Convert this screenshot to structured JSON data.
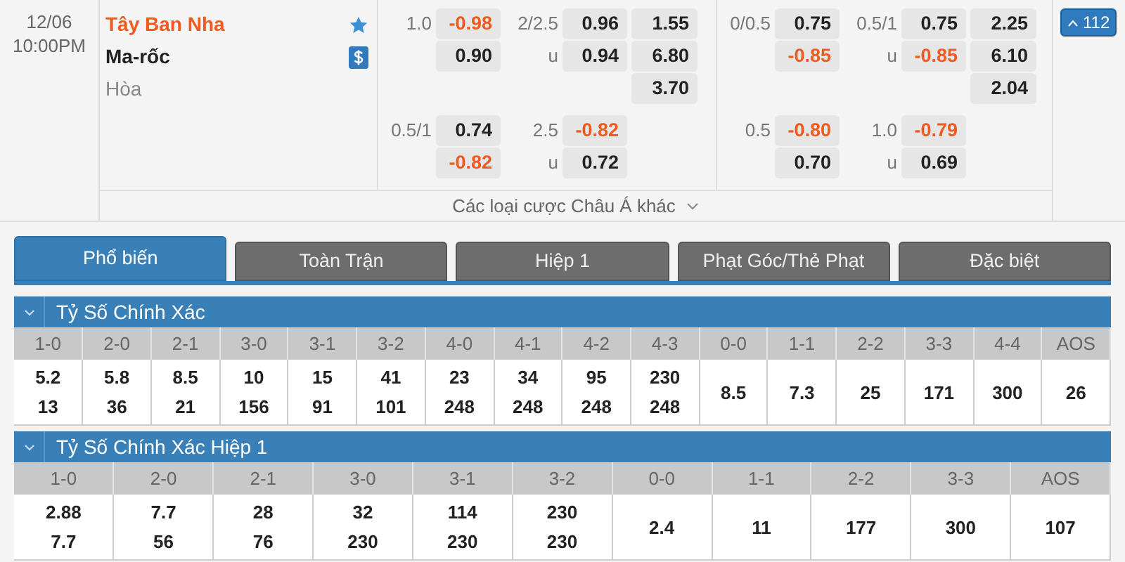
{
  "match": {
    "date": "12/06",
    "time": "10:00PM",
    "teams": [
      {
        "name": "Tây Ban Nha",
        "highlighted": true
      },
      {
        "name": "Ma-rốc",
        "highlighted": false
      }
    ],
    "draw_label": "Hòa",
    "market_groups": [
      {
        "blocks": [
          {
            "handicap_line": "1.0",
            "handicap": [
              {
                "value": "-0.98",
                "negative": true
              },
              {
                "value": "0.90",
                "negative": false
              }
            ],
            "total_line": "2/2.5",
            "under_label": "u",
            "total": [
              {
                "value": "0.96",
                "negative": false
              },
              {
                "value": "0.94",
                "negative": false
              }
            ],
            "one_x_two": [
              "1.55",
              "6.80",
              "3.70"
            ]
          },
          {
            "handicap_line": "0.5/1",
            "handicap": [
              {
                "value": "0.74",
                "negative": false
              },
              {
                "value": "-0.82",
                "negative": true
              }
            ],
            "total_line": "2.5",
            "under_label": "u",
            "total": [
              {
                "value": "-0.82",
                "negative": true
              },
              {
                "value": "0.72",
                "negative": false
              }
            ]
          }
        ]
      },
      {
        "blocks": [
          {
            "handicap_line": "0/0.5",
            "handicap": [
              {
                "value": "0.75",
                "negative": false
              },
              {
                "value": "-0.85",
                "negative": true
              }
            ],
            "total_line": "0.5/1",
            "under_label": "u",
            "total": [
              {
                "value": "0.75",
                "negative": false
              },
              {
                "value": "-0.85",
                "negative": true
              }
            ],
            "one_x_two": [
              "2.25",
              "6.10",
              "2.04"
            ]
          },
          {
            "handicap_line": "0.5",
            "handicap": [
              {
                "value": "-0.80",
                "negative": true
              },
              {
                "value": "0.70",
                "negative": false
              }
            ],
            "total_line": "1.0",
            "under_label": "u",
            "total": [
              {
                "value": "-0.79",
                "negative": true
              },
              {
                "value": "0.69",
                "negative": false
              }
            ]
          }
        ]
      }
    ],
    "more_markets": "Các loại cược Châu Á khác",
    "markets_count": "112"
  },
  "tabs": [
    {
      "label": "Phổ biến",
      "selected": true
    },
    {
      "label": "Toàn Trận",
      "selected": false
    },
    {
      "label": "Hiệp 1",
      "selected": false
    },
    {
      "label": "Phạt Góc/Thẻ Phạt",
      "selected": false
    },
    {
      "label": "Đặc biệt",
      "selected": false
    }
  ],
  "sections": [
    {
      "title": "Tỷ Số Chính Xác",
      "expanded": true,
      "scores": [
        {
          "label": "1-0",
          "values": [
            "5.2",
            "13"
          ]
        },
        {
          "label": "2-0",
          "values": [
            "5.8",
            "36"
          ]
        },
        {
          "label": "2-1",
          "values": [
            "8.5",
            "21"
          ]
        },
        {
          "label": "3-0",
          "values": [
            "10",
            "156"
          ]
        },
        {
          "label": "3-1",
          "values": [
            "15",
            "91"
          ]
        },
        {
          "label": "3-2",
          "values": [
            "41",
            "101"
          ]
        },
        {
          "label": "4-0",
          "values": [
            "23",
            "248"
          ]
        },
        {
          "label": "4-1",
          "values": [
            "34",
            "248"
          ]
        },
        {
          "label": "4-2",
          "values": [
            "95",
            "248"
          ]
        },
        {
          "label": "4-3",
          "values": [
            "230",
            "248"
          ]
        },
        {
          "label": "0-0",
          "values": [
            "8.5"
          ]
        },
        {
          "label": "1-1",
          "values": [
            "7.3"
          ]
        },
        {
          "label": "2-2",
          "values": [
            "25"
          ]
        },
        {
          "label": "3-3",
          "values": [
            "171"
          ]
        },
        {
          "label": "4-4",
          "values": [
            "300"
          ]
        },
        {
          "label": "AOS",
          "values": [
            "26"
          ]
        }
      ]
    },
    {
      "title": "Tỷ Số Chính Xác Hiệp 1",
      "expanded": true,
      "scores": [
        {
          "label": "1-0",
          "values": [
            "2.88",
            "7.7"
          ]
        },
        {
          "label": "2-0",
          "values": [
            "7.7",
            "56"
          ]
        },
        {
          "label": "2-1",
          "values": [
            "28",
            "76"
          ]
        },
        {
          "label": "3-0",
          "values": [
            "32",
            "230"
          ]
        },
        {
          "label": "3-1",
          "values": [
            "114",
            "230"
          ]
        },
        {
          "label": "3-2",
          "values": [
            "230",
            "230"
          ]
        },
        {
          "label": "0-0",
          "values": [
            "2.4"
          ]
        },
        {
          "label": "1-1",
          "values": [
            "11"
          ]
        },
        {
          "label": "2-2",
          "values": [
            "177"
          ]
        },
        {
          "label": "3-3",
          "values": [
            "300"
          ]
        },
        {
          "label": "AOS",
          "values": [
            "107"
          ]
        }
      ]
    }
  ]
}
